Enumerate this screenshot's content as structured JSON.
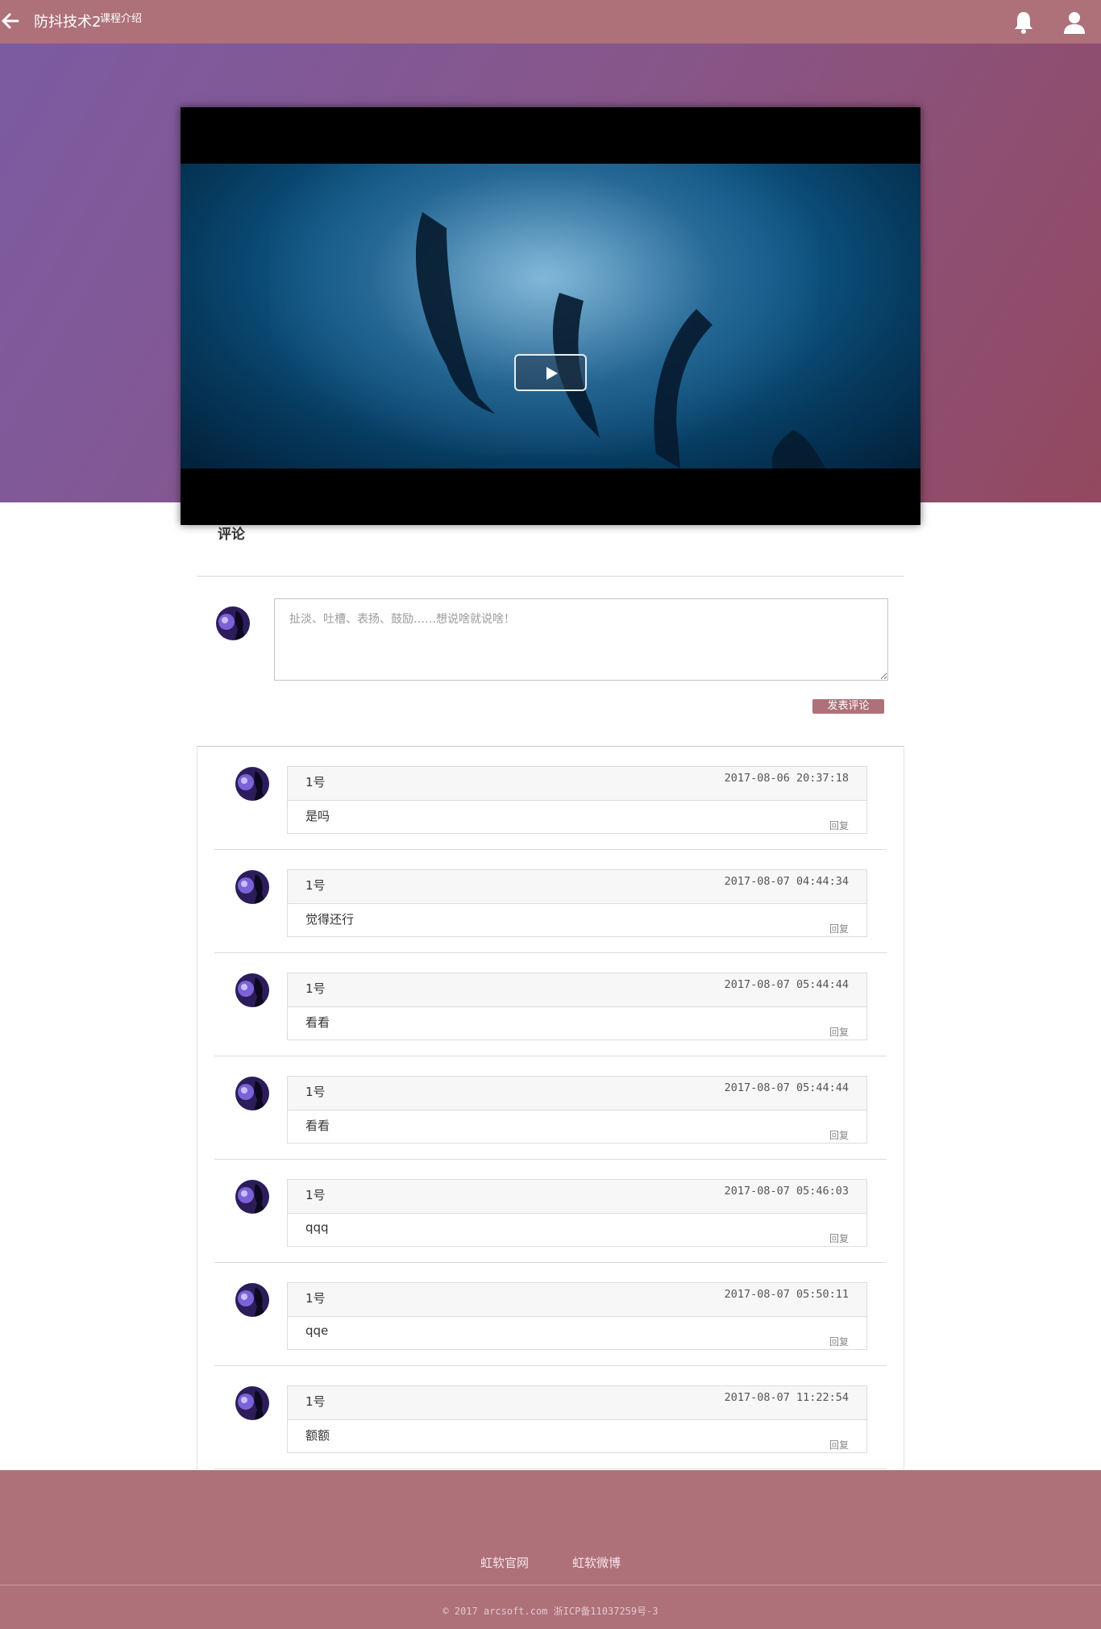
{
  "header": {
    "title": "防抖技术2",
    "subtitle": "课程介绍"
  },
  "icons": {
    "back": "arrow-left-icon",
    "bell": "bell-icon",
    "user": "user-icon",
    "play": "play-icon"
  },
  "colors": {
    "brand": "#ae7079",
    "hero_from": "#7c5ba2",
    "hero_to": "#93495f"
  },
  "comments": {
    "title": "评论",
    "placeholder": "扯淡、吐槽、表扬、鼓励……想说啥就说啥！",
    "submit_label": "发表评论",
    "items": [
      {
        "author": "1号",
        "time": "2017-08-06 20:37:18",
        "text": "是吗",
        "reply": "回复"
      },
      {
        "author": "1号",
        "time": "2017-08-07 04:44:34",
        "text": "觉得还行",
        "reply": "回复"
      },
      {
        "author": "1号",
        "time": "2017-08-07 05:44:44",
        "text": "看看",
        "reply": "回复"
      },
      {
        "author": "1号",
        "time": "2017-08-07 05:44:44",
        "text": "看看",
        "reply": "回复"
      },
      {
        "author": "1号",
        "time": "2017-08-07 05:46:03",
        "text": "qqq",
        "reply": "回复"
      },
      {
        "author": "1号",
        "time": "2017-08-07 05:50:11",
        "text": "qqe",
        "reply": "回复"
      },
      {
        "author": "1号",
        "time": "2017-08-07 11:22:54",
        "text": "额额",
        "reply": "回复"
      }
    ]
  },
  "footer": {
    "link1": "虹软官网",
    "link2": "虹软微博",
    "copyright": "© 2017 arcsoft.com  浙ICP备11037259号-3"
  }
}
